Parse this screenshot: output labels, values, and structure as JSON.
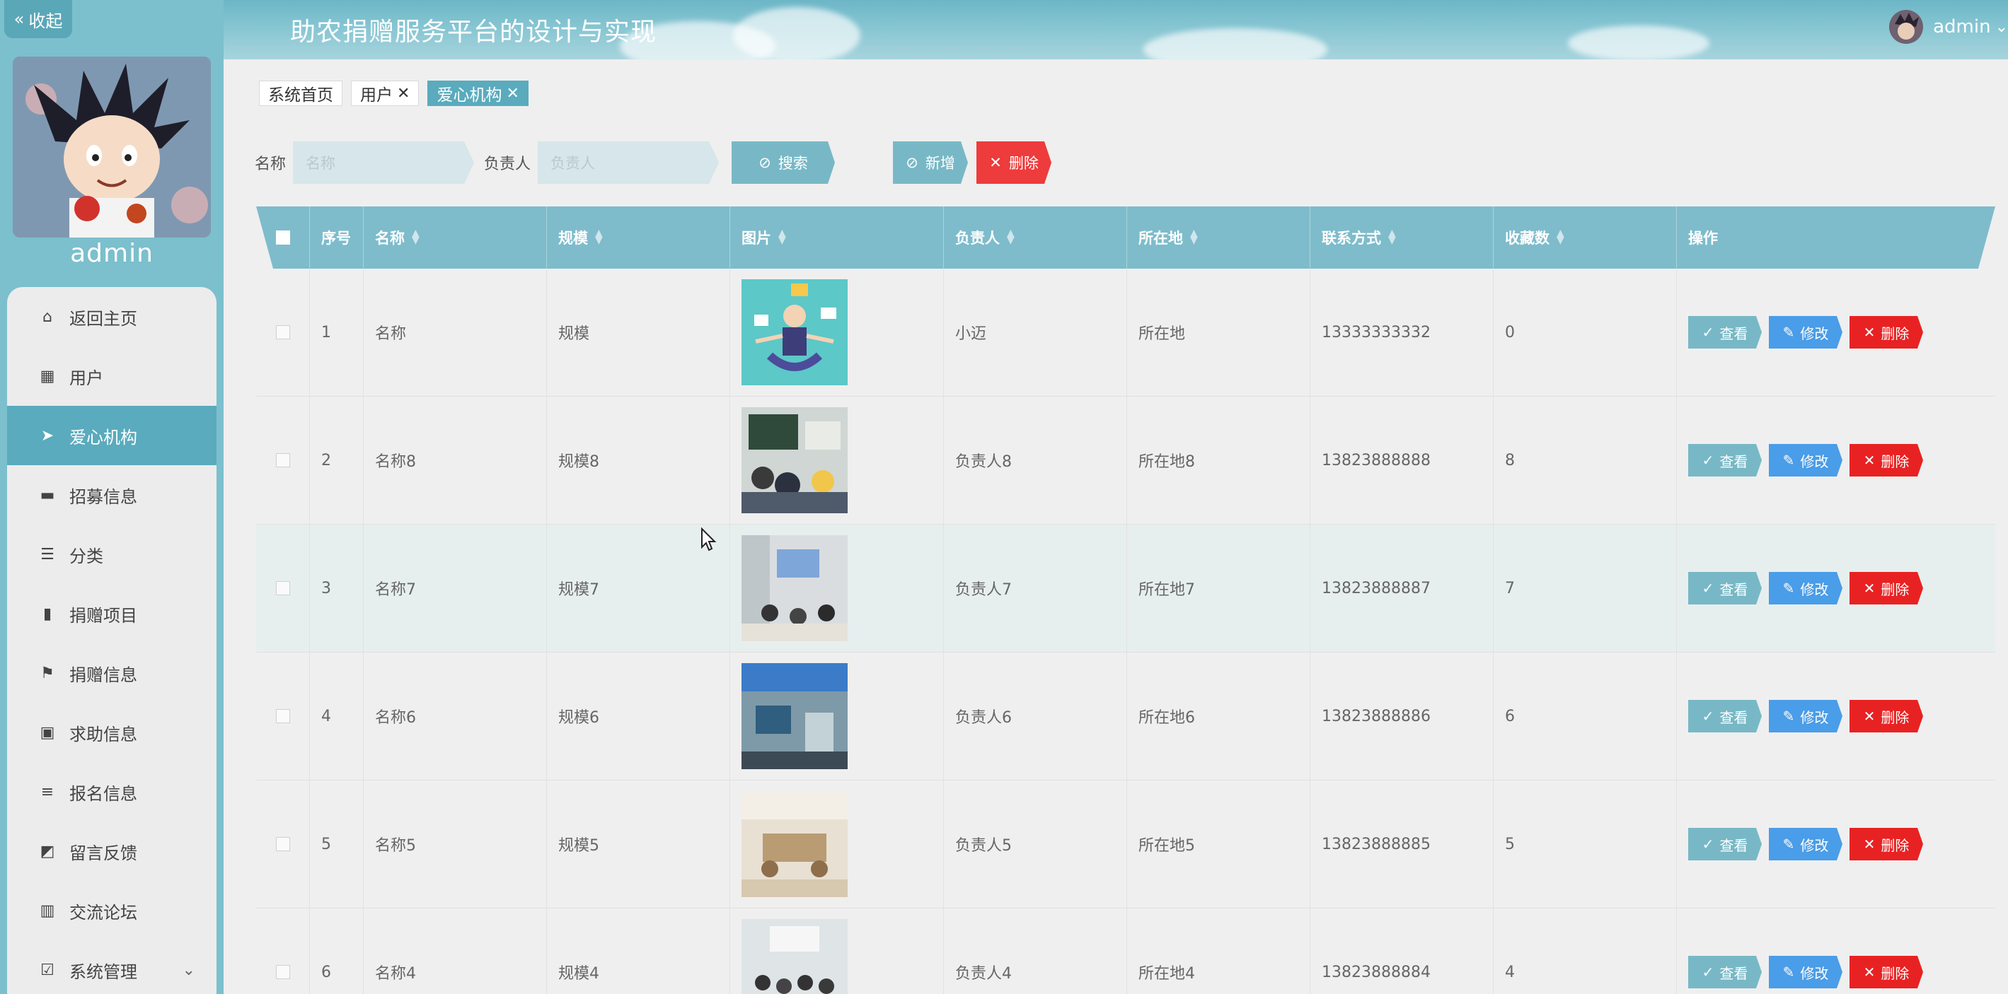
{
  "header": {
    "title": "助农捐赠服务平台的设计与实现",
    "username": "admin"
  },
  "sidebar": {
    "collapse_label": "收起",
    "username": "admin",
    "items": [
      {
        "label": "返回主页",
        "icon": "home-icon"
      },
      {
        "label": "用户",
        "icon": "grid-icon"
      },
      {
        "label": "爱心机构",
        "icon": "send-icon",
        "active": true
      },
      {
        "label": "招募信息",
        "icon": "printer-icon"
      },
      {
        "label": "分类",
        "icon": "sliders-icon"
      },
      {
        "label": "捐赠项目",
        "icon": "bookmark-icon"
      },
      {
        "label": "捐赠信息",
        "icon": "flag-icon"
      },
      {
        "label": "求助信息",
        "icon": "clipboard-icon"
      },
      {
        "label": "报名信息",
        "icon": "list-icon"
      },
      {
        "label": "留言反馈",
        "icon": "chart-icon"
      },
      {
        "label": "交流论坛",
        "icon": "bar-chart-icon"
      },
      {
        "label": "系统管理",
        "icon": "checklist-icon",
        "has_children": true
      }
    ]
  },
  "tags": [
    {
      "label": "系统首页"
    },
    {
      "label": "用户",
      "closable": true
    },
    {
      "label": "爱心机构",
      "closable": true,
      "active": true
    }
  ],
  "search": {
    "name_label": "名称",
    "name_placeholder": "名称",
    "manager_label": "负责人",
    "manager_placeholder": "负责人",
    "search_button": "搜索",
    "add_button": "新增",
    "delete_button": "删除"
  },
  "table": {
    "columns": [
      "序号",
      "名称",
      "规模",
      "图片",
      "负责人",
      "所在地",
      "联系方式",
      "收藏数",
      "操作"
    ],
    "rows": [
      {
        "index": "1",
        "name": "名称",
        "scale": "规模",
        "manager": "小迈",
        "location": "所在地",
        "phone": "13333333332",
        "favorites": "0"
      },
      {
        "index": "2",
        "name": "名称8",
        "scale": "规模8",
        "manager": "负责人8",
        "location": "所在地8",
        "phone": "13823888888",
        "favorites": "8"
      },
      {
        "index": "3",
        "name": "名称7",
        "scale": "规模7",
        "manager": "负责人7",
        "location": "所在地7",
        "phone": "13823888887",
        "favorites": "7"
      },
      {
        "index": "4",
        "name": "名称6",
        "scale": "规模6",
        "manager": "负责人6",
        "location": "所在地6",
        "phone": "13823888886",
        "favorites": "6"
      },
      {
        "index": "5",
        "name": "名称5",
        "scale": "规模5",
        "manager": "负责人5",
        "location": "所在地5",
        "phone": "13823888885",
        "favorites": "5"
      },
      {
        "index": "6",
        "name": "名称4",
        "scale": "规模4",
        "manager": "负责人4",
        "location": "所在地4",
        "phone": "13823888884",
        "favorites": "4"
      }
    ],
    "actions": {
      "view": "查看",
      "edit": "修改",
      "delete": "删除"
    }
  },
  "colors": {
    "accent": "#5aabbd",
    "header_bg": "#7ebccb",
    "edit": "#4a9de8",
    "delete": "#e82222"
  }
}
